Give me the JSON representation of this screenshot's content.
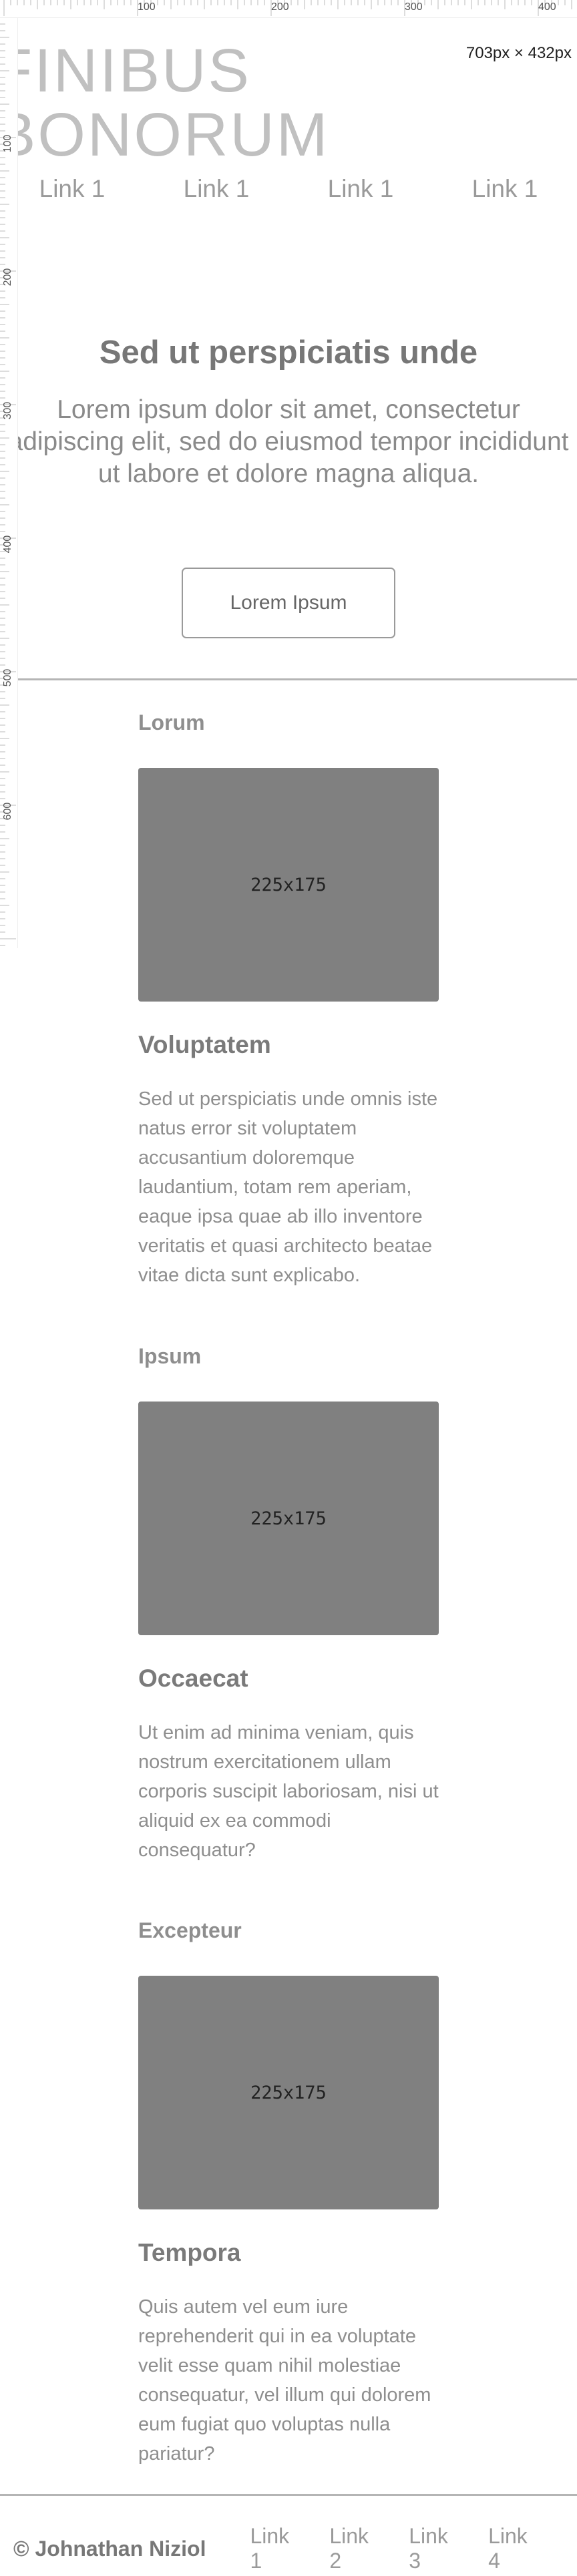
{
  "ruler": {
    "top_ticks": [
      "100",
      "200",
      "300",
      "400"
    ],
    "left_ticks": [
      "100",
      "200",
      "300",
      "400",
      "500",
      "600"
    ],
    "viewport_size": "703px × 432px"
  },
  "header": {
    "title_line_1": "FINIBUS",
    "title_line_2": "BONORUM",
    "nav": [
      "Link 1",
      "Link 1",
      "Link 1",
      "Link 1"
    ]
  },
  "hero": {
    "title": "Sed ut perspiciatis unde",
    "text_lines": [
      "Lorem ipsum dolor sit amet, consectetur",
      "adipiscing elit, sed do eiusmod tempor incididunt",
      "ut labore et dolore magna aliqua."
    ],
    "button_label": "Lorem Ipsum"
  },
  "articles": [
    {
      "label": "Lorum",
      "image_text": "225x175",
      "heading": "Voluptatem",
      "body": "Sed ut perspiciatis unde omnis iste natus error sit voluptatem accusantium doloremque laudantium, totam rem aperiam, eaque ipsa quae ab illo inventore veritatis et quasi architecto beatae vitae dicta sunt explicabo."
    },
    {
      "label": "Ipsum",
      "image_text": "225x175",
      "heading": "Occaecat",
      "body": "Ut enim ad minima veniam, quis nostrum exercitationem ullam corporis suscipit laboriosam, nisi ut aliquid ex ea commodi consequatur?"
    },
    {
      "label": "Excepteur",
      "image_text": "225x175",
      "heading": "Tempora",
      "body": "Quis autem vel eum iure reprehenderit qui in ea voluptate velit esse quam nihil molestiae consequatur, vel illum qui dolorem eum fugiat quo voluptas nulla pariatur?"
    }
  ],
  "footer": {
    "copyright": "© Johnathan Niziol",
    "links": [
      "Link 1",
      "Link 2",
      "Link 3",
      "Link 4"
    ]
  },
  "colors": {
    "image_placeholder": "#808080",
    "divider": "#b5b5b5",
    "text": "#8a8a8a"
  }
}
